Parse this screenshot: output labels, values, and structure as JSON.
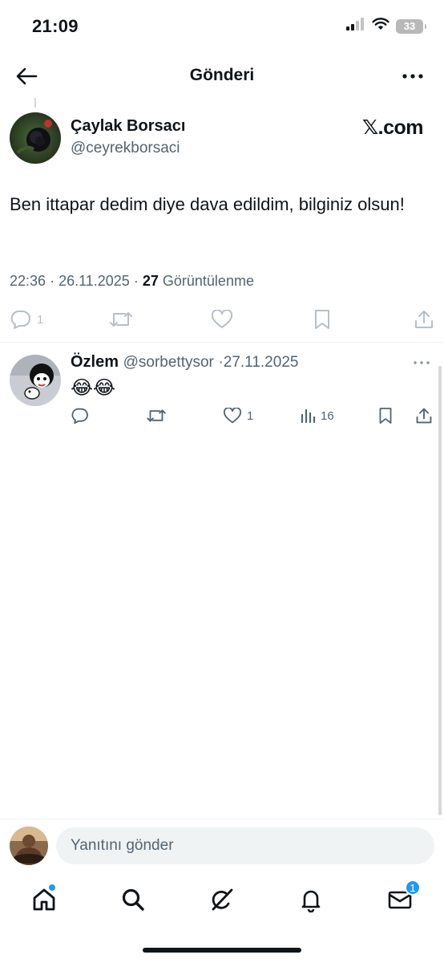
{
  "status_bar": {
    "time": "21:09",
    "battery": "33"
  },
  "header": {
    "title": "Gönderi"
  },
  "post": {
    "author_name": "Çaylak Borsacı",
    "author_handle": "@ceyrekborsaci",
    "source_badge": "𝕏.com",
    "text": "Ben ittapar dedim diye dava edildim, bilginiz olsun!",
    "time": "22:36",
    "date": "26.11.2025",
    "views_count": "27",
    "views_label": "Görüntülenme",
    "reply_count": "1"
  },
  "reply": {
    "name": "Özlem",
    "handle": "@sorbettysor",
    "date": "27.11.2025",
    "text": "😂😂",
    "like_count": "1",
    "view_count": "16"
  },
  "composer": {
    "placeholder": "Yanıtını gönder"
  },
  "nav": {
    "messages_badge": "1"
  },
  "colors": {
    "accent": "#1d9bf0",
    "text": "#0f1419",
    "muted": "#536471"
  }
}
